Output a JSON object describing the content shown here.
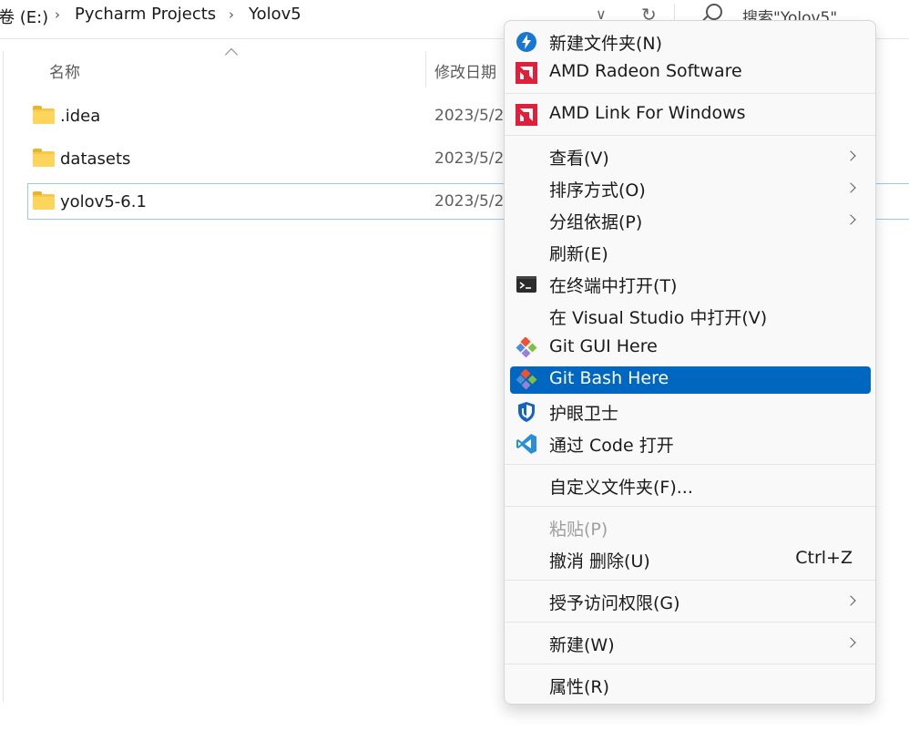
{
  "address_bar": {
    "crumbs": [
      "卷 (E:)",
      "Pycharm Projects",
      "Yolov5"
    ],
    "search_placeholder": "搜索\"Yolov5\""
  },
  "columns": {
    "name": "名称",
    "date": "修改日期"
  },
  "files": [
    {
      "name": ".idea",
      "date": "2023/5/2"
    },
    {
      "name": "datasets",
      "date": "2023/5/2"
    },
    {
      "name": "yolov5-6.1",
      "date": "2023/5/2"
    }
  ],
  "menu": {
    "new_folder": "新建文件夹(N)",
    "amd_radeon": "AMD Radeon Software",
    "amd_link": "AMD Link For Windows",
    "view": "查看(V)",
    "sort": "排序方式(O)",
    "group": "分组依据(P)",
    "refresh": "刷新(E)",
    "terminal": "在终端中打开(T)",
    "visual_studio": "在 Visual Studio 中打开(V)",
    "git_gui": "Git GUI Here",
    "git_bash": "Git Bash Here",
    "eye_guard": "护眼卫士",
    "vscode": "通过 Code 打开",
    "customize": "自定义文件夹(F)...",
    "paste": "粘贴(P)",
    "undo": "撤消 删除(U)",
    "undo_shortcut": "Ctrl+Z",
    "grant_access": "授予访问权限(G)",
    "new": "新建(W)",
    "properties": "属性(R)"
  },
  "colors": {
    "highlight": "#0067c0",
    "amd_red": "#e0203a",
    "vscode_blue": "#2b8fd8",
    "git_orange": "#f05133"
  }
}
